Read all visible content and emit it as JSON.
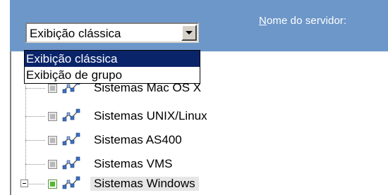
{
  "header": {
    "server_label": "Nome do servidor:",
    "server_label_mnemonic": "N",
    "server_label_rest": "ome do servidor:"
  },
  "view_select": {
    "value": "Exibição clássica",
    "options": [
      "Exibição clássica",
      "Exibição de grupo"
    ],
    "selected_index": 0
  },
  "tree": {
    "items": [
      {
        "label": "Sistemas Mac OS X",
        "checked": false
      },
      {
        "label": "Sistemas UNIX/Linux",
        "checked": false
      },
      {
        "label": "Sistemas AS400",
        "checked": false
      },
      {
        "label": "Sistemas VMS",
        "checked": false
      },
      {
        "label": "Sistemas Windows",
        "checked": true,
        "expandable": true,
        "highlighted": true
      }
    ]
  },
  "colors": {
    "header": "#6d97c9",
    "selection": "#0a246a",
    "checked": "#4cbb2c"
  }
}
